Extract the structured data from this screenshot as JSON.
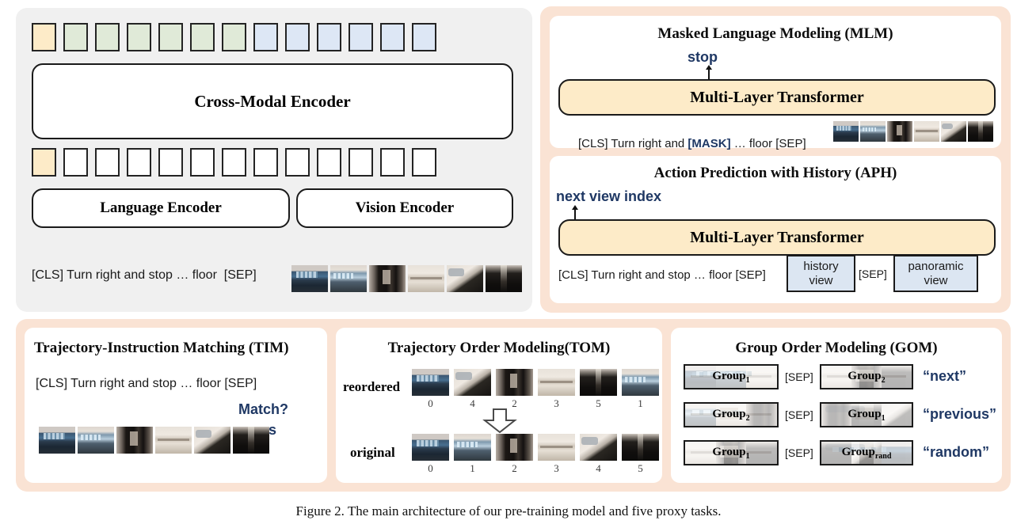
{
  "figure": {
    "caption": "Figure 2. The main architecture of our pre-training model and five proxy tasks."
  },
  "colors": {
    "peach_background": "#FAE3D4",
    "gray_panel": "#F0F0F0",
    "token_yellow": "#FDEBC8",
    "token_green": "#E0EAD8",
    "token_blue": "#DDE7F5",
    "transformer_yellow": "#FDEBC8",
    "view_box_blue": "#DCE6F2",
    "accent_blue_text": "#1F3864"
  },
  "architecture": {
    "top_tokens": [
      "yellow",
      "green",
      "green",
      "green",
      "green",
      "green",
      "green",
      "blue",
      "blue",
      "blue",
      "blue",
      "blue",
      "blue"
    ],
    "cross_modal_encoder_label": "Cross-Modal Encoder",
    "mid_tokens": [
      "yellow",
      "white",
      "white",
      "white",
      "white",
      "white",
      "white",
      "white",
      "white",
      "white",
      "white",
      "white",
      "white"
    ],
    "language_encoder_label": "Language Encoder",
    "vision_encoder_label": "Vision Encoder",
    "input_text": "[CLS] Turn right and stop … floor  [SEP]",
    "thumbnails": [
      "living-room-window",
      "living-room-ceiling",
      "dark-doorway",
      "kitchen-shelf",
      "counter-dark-table",
      "dark-hallway"
    ]
  },
  "mlm": {
    "title": "Masked Language Modeling (MLM)",
    "prediction": "stop",
    "transformer_label": "Multi-Layer Transformer",
    "input_prefix": "[CLS] Turn right and ",
    "input_mask": "[MASK]",
    "input_suffix": " … floor [SEP]",
    "thumbnails": [
      "living-room-window",
      "living-room-ceiling",
      "dark-doorway",
      "kitchen-shelf",
      "counter-dark-table",
      "dark-hallway"
    ]
  },
  "aph": {
    "title": "Action Prediction with History (APH)",
    "prediction": "next view index",
    "transformer_label": "Multi-Layer Transformer",
    "input_text": "[CLS] Turn right and stop … floor [SEP]",
    "history_view_label": "history\nview",
    "sep_label": "[SEP]",
    "panoramic_view_label": "panoramic\nview"
  },
  "tim": {
    "title": "Trajectory-Instruction Matching (TIM)",
    "input_text": "[CLS] Turn right and stop … floor [SEP]",
    "question": "Match?",
    "answer": "yes",
    "thumbnails": [
      "living-room-window",
      "living-room-ceiling",
      "dark-doorway",
      "kitchen-shelf",
      "counter-dark-table",
      "dark-hallway"
    ]
  },
  "tom": {
    "title": "Trajectory Order Modeling(TOM)",
    "reordered_label": "reordered",
    "original_label": "original",
    "reordered_indices": [
      "0",
      "4",
      "2",
      "3",
      "5",
      "1"
    ],
    "original_indices": [
      "0",
      "1",
      "2",
      "3",
      "4",
      "5"
    ],
    "reordered_thumbnails": [
      "living-room-window",
      "counter-dark-table",
      "dark-doorway",
      "kitchen-shelf",
      "dark-hallway",
      "living-room-ceiling"
    ],
    "original_thumbnails": [
      "living-room-window",
      "living-room-ceiling",
      "dark-doorway",
      "kitchen-shelf",
      "counter-dark-table",
      "dark-hallway"
    ]
  },
  "gom": {
    "title": "Group Order Modeling (GOM)",
    "sep_label": "[SEP]",
    "rows": [
      {
        "left": "Group",
        "left_sub": "1",
        "right": "Group",
        "right_sub": "2",
        "answer": "“next”"
      },
      {
        "left": "Group",
        "left_sub": "2",
        "right": "Group",
        "right_sub": "1",
        "answer": "“previous”"
      },
      {
        "left": "Group",
        "left_sub": "1",
        "right": "Group",
        "right_sub": "rand",
        "answer": "“random”"
      }
    ]
  }
}
